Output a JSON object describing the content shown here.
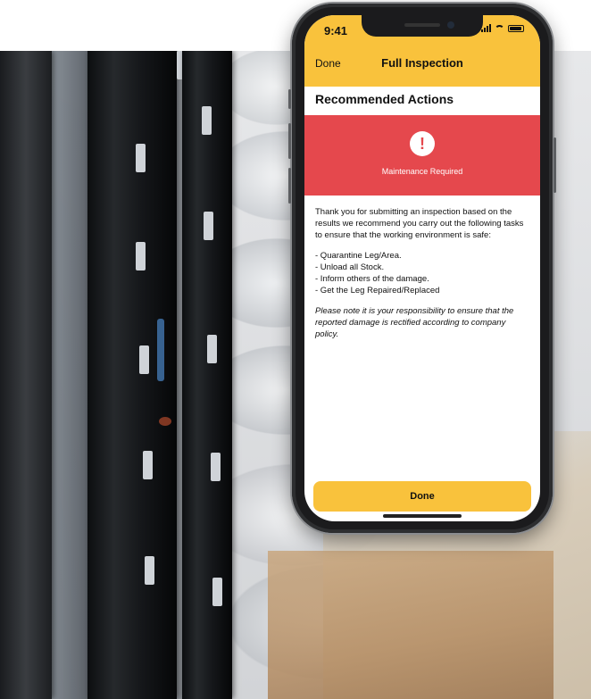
{
  "status_bar": {
    "time": "9:41"
  },
  "nav": {
    "back_label": "Done",
    "title": "Full Inspection"
  },
  "section_title": "Recommended Actions",
  "alert": {
    "icon": "!",
    "message": "Maintenance Required",
    "color": "#e5484d"
  },
  "intro": "Thank you for submitting an inspection based on the results we recommend you carry out the following tasks to ensure that the working environment is safe:",
  "actions": [
    "- Quarantine Leg/Area.",
    "- Unload all Stock.",
    "- Inform others of the damage.",
    "- Get the Leg Repaired/Replaced"
  ],
  "note": "Please note it is your responsibility to ensure that the reported damage is rectified according to company policy.",
  "primary_button": {
    "label": "Done"
  },
  "colors": {
    "accent": "#f9c23c",
    "alert": "#e5484d"
  }
}
